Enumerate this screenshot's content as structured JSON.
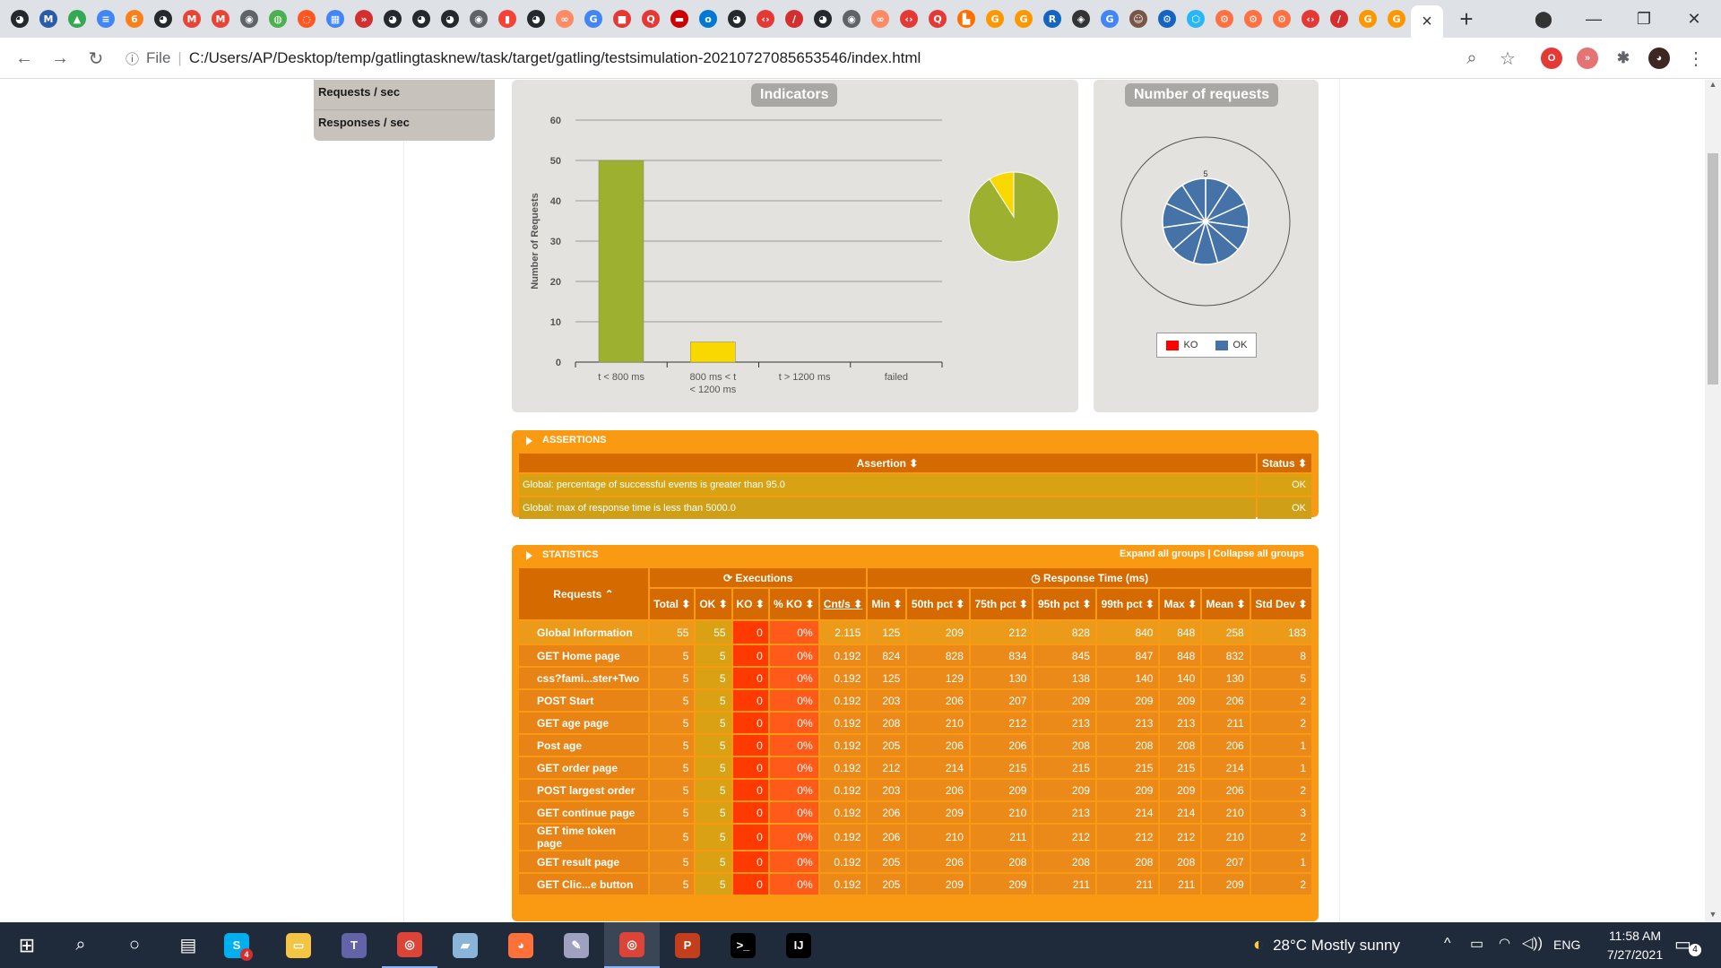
{
  "browser": {
    "address": "C:/Users/AP/Desktop/temp/gatlingtasknew/task/target/gatling/testsimulation-20210727085653546/index.html",
    "scheme_label": "File",
    "tab_icons": [
      {
        "icon": "github-icon",
        "glyph": "◕",
        "color": "#24292e"
      },
      {
        "icon": "mvn-icon",
        "glyph": "M",
        "color": "#2a5caa"
      },
      {
        "icon": "drive-icon",
        "glyph": "▲",
        "color": "#34a853"
      },
      {
        "icon": "docs-icon",
        "glyph": "≡",
        "color": "#4285f4"
      },
      {
        "icon": "swiggy-icon",
        "glyph": "6",
        "color": "#fc8019"
      },
      {
        "icon": "github-icon",
        "glyph": "◕",
        "color": "#24292e"
      },
      {
        "icon": "gmail-icon",
        "glyph": "M",
        "color": "#ea4335"
      },
      {
        "icon": "gmail-icon",
        "glyph": "M",
        "color": "#ea4335"
      },
      {
        "icon": "globe-icon",
        "glyph": "◉",
        "color": "#5f6368"
      },
      {
        "icon": "green-circle-icon",
        "glyph": "◍",
        "color": "#4caf50"
      },
      {
        "icon": "red-circle-icon",
        "glyph": "◌",
        "color": "#ff5722"
      },
      {
        "icon": "grid-icon",
        "glyph": "▦",
        "color": "#4285f4"
      },
      {
        "icon": "chevrons-icon",
        "glyph": "»",
        "color": "#d32f2f"
      },
      {
        "icon": "github-icon",
        "glyph": "◕",
        "color": "#24292e"
      },
      {
        "icon": "github-icon",
        "glyph": "◕",
        "color": "#24292e"
      },
      {
        "icon": "github-icon",
        "glyph": "◕",
        "color": "#24292e"
      },
      {
        "icon": "globe-icon",
        "glyph": "◉",
        "color": "#5f6368"
      },
      {
        "icon": "stack-icon",
        "glyph": "▮",
        "color": "#f44336"
      },
      {
        "icon": "github-icon",
        "glyph": "◕",
        "color": "#24292e"
      },
      {
        "icon": "link-icon",
        "glyph": "∞",
        "color": "#ff8a65"
      },
      {
        "icon": "google-icon",
        "glyph": "G",
        "color": "#4285f4"
      },
      {
        "icon": "red-square-icon",
        "glyph": "■",
        "color": "#e53935"
      },
      {
        "icon": "qa-icon",
        "glyph": "Q",
        "color": "#e53935"
      },
      {
        "icon": "redhat-icon",
        "glyph": "▬",
        "color": "#cc0000"
      },
      {
        "icon": "outlook-icon",
        "glyph": "o",
        "color": "#0078d4"
      },
      {
        "icon": "github-icon",
        "glyph": "◕",
        "color": "#24292e"
      },
      {
        "icon": "code-icon",
        "glyph": "‹›",
        "color": "#e53935"
      },
      {
        "icon": "pen-icon",
        "glyph": "/",
        "color": "#d32f2f"
      },
      {
        "icon": "github-icon",
        "glyph": "◕",
        "color": "#24292e"
      },
      {
        "icon": "globe-icon",
        "glyph": "◉",
        "color": "#5f6368"
      },
      {
        "icon": "link-icon",
        "glyph": "∞",
        "color": "#ff8a65"
      },
      {
        "icon": "code-icon",
        "glyph": "‹›",
        "color": "#e53935"
      },
      {
        "icon": "qa-icon",
        "glyph": "Q",
        "color": "#e53935"
      },
      {
        "icon": "puzzle-icon",
        "glyph": "▙",
        "color": "#ff6f00"
      },
      {
        "icon": "google-icon",
        "glyph": "G",
        "color": "#ff9800"
      },
      {
        "icon": "google-icon",
        "glyph": "G",
        "color": "#ff9800"
      },
      {
        "icon": "r-icon",
        "glyph": "R",
        "color": "#1565c0"
      },
      {
        "icon": "diamond-icon",
        "glyph": "◈",
        "color": "#333333"
      },
      {
        "icon": "google-icon",
        "glyph": "G",
        "color": "#4285f4"
      },
      {
        "icon": "avatar-icon",
        "glyph": "☺",
        "color": "#795548"
      },
      {
        "icon": "gear-icon",
        "glyph": "⚙",
        "color": "#1565c0"
      },
      {
        "icon": "hex-icon",
        "glyph": "⬡",
        "color": "#29b6f6"
      },
      {
        "icon": "gear-icon",
        "glyph": "⚙",
        "color": "#ff7043"
      },
      {
        "icon": "gear-icon",
        "glyph": "⚙",
        "color": "#ff7043"
      },
      {
        "icon": "gear-icon",
        "glyph": "⚙",
        "color": "#ff7043"
      },
      {
        "icon": "code-icon",
        "glyph": "‹›",
        "color": "#e53935"
      },
      {
        "icon": "pen-icon",
        "glyph": "/",
        "color": "#d32f2f"
      },
      {
        "icon": "google-icon",
        "glyph": "G",
        "color": "#ff9800"
      },
      {
        "icon": "google-icon",
        "glyph": "G",
        "color": "#ff9800"
      }
    ],
    "active_tab_close": "×",
    "newtab_glyph": "+"
  },
  "sidemenu": {
    "items": [
      "Requests / sec",
      "Responses / sec"
    ]
  },
  "indicators": {
    "title": "Indicators",
    "ylabel": "Number of Requests",
    "pie": [
      {
        "label": "t < 800 ms",
        "value": 50,
        "color": "#9db02f"
      },
      {
        "label": "800 ms < t < 1200 ms",
        "value": 5,
        "color": "#f8d800"
      }
    ]
  },
  "chart_data": [
    {
      "type": "bar",
      "title": "Indicators",
      "ylabel": "Number of Requests",
      "xlabel": "",
      "categories": [
        "t < 800 ms",
        "800 ms < t < 1200 ms",
        "t > 1200 ms",
        "failed"
      ],
      "values": [
        50,
        5,
        0,
        0
      ],
      "colors": [
        "#9db02f",
        "#f8d800",
        "#f18f00",
        "#e03c1b"
      ],
      "ylim": [
        0,
        60
      ],
      "yticks": [
        "0",
        "10",
        "20",
        "30",
        "40",
        "50",
        "60"
      ],
      "grid": true
    },
    {
      "type": "pie",
      "title": "Number of requests",
      "categories": [
        "GET Home page",
        "css?fami...ster+Two",
        "POST Start",
        "GET age page",
        "Post age",
        "GET order page",
        "POST largest order",
        "GET continue page",
        "GET time token page",
        "GET result page",
        "GET Clic...e button"
      ],
      "values": [
        5,
        5,
        5,
        5,
        5,
        5,
        5,
        5,
        5,
        5,
        5
      ],
      "slice_label": "5",
      "legend": [
        "KO",
        "OK"
      ],
      "legend_colors": [
        "#ff0000",
        "#4572a7"
      ],
      "legend_position": "bottom"
    }
  ],
  "requests_chart": {
    "title": "Number of requests",
    "legend_ko": "KO",
    "legend_ok": "OK"
  },
  "assertions": {
    "header": "ASSERTIONS",
    "col_assertion": "Assertion ⬍",
    "col_status": "Status ⬍",
    "rows": [
      {
        "text": "Global: percentage of successful events is greater than 95.0",
        "status": "OK"
      },
      {
        "text": "Global: max of response time is less than 5000.0",
        "status": "OK"
      }
    ]
  },
  "statistics": {
    "header": "STATISTICS",
    "expand": "Expand all groups",
    "sep": " | ",
    "collapse": "Collapse all groups",
    "col_requests": "Requests ⌃",
    "group_exec": "Executions",
    "group_rt": "Response Time (ms)",
    "columns": [
      "Total ⬍",
      "OK ⬍",
      "KO ⬍",
      "% KO ⬍",
      "Cnt/s ⬍",
      "Min ⬍",
      "50th pct ⬍",
      "75th pct ⬍",
      "95th pct ⬍",
      "99th pct ⬍",
      "Max ⬍",
      "Mean ⬍",
      "Std Dev ⬍"
    ],
    "global": [
      "Global Information",
      "55",
      "55",
      "0",
      "0%",
      "2.115",
      "125",
      "209",
      "212",
      "828",
      "840",
      "848",
      "258",
      "183"
    ],
    "rows": [
      [
        "GET Home page",
        "5",
        "5",
        "0",
        "0%",
        "0.192",
        "824",
        "828",
        "834",
        "845",
        "847",
        "848",
        "832",
        "8"
      ],
      [
        "css?fami...ster+Two",
        "5",
        "5",
        "0",
        "0%",
        "0.192",
        "125",
        "129",
        "130",
        "138",
        "140",
        "140",
        "130",
        "5"
      ],
      [
        "POST Start",
        "5",
        "5",
        "0",
        "0%",
        "0.192",
        "203",
        "206",
        "207",
        "209",
        "209",
        "209",
        "206",
        "2"
      ],
      [
        "GET age page",
        "5",
        "5",
        "0",
        "0%",
        "0.192",
        "208",
        "210",
        "212",
        "213",
        "213",
        "213",
        "211",
        "2"
      ],
      [
        "Post age",
        "5",
        "5",
        "0",
        "0%",
        "0.192",
        "205",
        "206",
        "206",
        "208",
        "208",
        "208",
        "206",
        "1"
      ],
      [
        "GET order page",
        "5",
        "5",
        "0",
        "0%",
        "0.192",
        "212",
        "214",
        "215",
        "215",
        "215",
        "215",
        "214",
        "1"
      ],
      [
        "POST largest order",
        "5",
        "5",
        "0",
        "0%",
        "0.192",
        "203",
        "206",
        "209",
        "209",
        "209",
        "209",
        "206",
        "2"
      ],
      [
        "GET continue page",
        "5",
        "5",
        "0",
        "0%",
        "0.192",
        "206",
        "209",
        "210",
        "213",
        "214",
        "214",
        "210",
        "3"
      ],
      [
        "GET time token page",
        "5",
        "5",
        "0",
        "0%",
        "0.192",
        "206",
        "210",
        "211",
        "212",
        "212",
        "212",
        "210",
        "2"
      ],
      [
        "GET result page",
        "5",
        "5",
        "0",
        "0%",
        "0.192",
        "205",
        "206",
        "208",
        "208",
        "208",
        "208",
        "207",
        "1"
      ],
      [
        "GET Clic...e button",
        "5",
        "5",
        "0",
        "0%",
        "0.192",
        "205",
        "209",
        "209",
        "211",
        "211",
        "211",
        "209",
        "2"
      ]
    ]
  },
  "taskbar": {
    "weather": "28°C  Mostly sunny",
    "lang": "ENG",
    "time": "11:58 AM",
    "date": "7/27/2021",
    "notif_count": "4",
    "skype_badge": "4",
    "apps": [
      {
        "icon": "skype-icon",
        "glyph": "S",
        "color": "#00aff0"
      },
      {
        "icon": "file-explorer-icon",
        "glyph": "▭",
        "color": "#f4c542"
      },
      {
        "icon": "teams-icon",
        "glyph": "T",
        "color": "#6264a7"
      },
      {
        "icon": "chrome-icon",
        "glyph": "◎",
        "color": "#db4437"
      },
      {
        "icon": "notepad-icon",
        "glyph": "▰",
        "color": "#8ab4d8"
      },
      {
        "icon": "firefox-icon",
        "glyph": "◕",
        "color": "#ff7139"
      },
      {
        "icon": "eclipse-icon",
        "glyph": "✎",
        "color": "#a0a0c0"
      },
      {
        "icon": "chrome-icon",
        "glyph": "◎",
        "color": "#db4437"
      },
      {
        "icon": "powerpoint-icon",
        "glyph": "P",
        "color": "#c43e1c"
      },
      {
        "icon": "terminal-icon",
        "glyph": ">_",
        "color": "#000000"
      },
      {
        "icon": "intellij-icon",
        "glyph": "IJ",
        "color": "#000000"
      }
    ]
  }
}
